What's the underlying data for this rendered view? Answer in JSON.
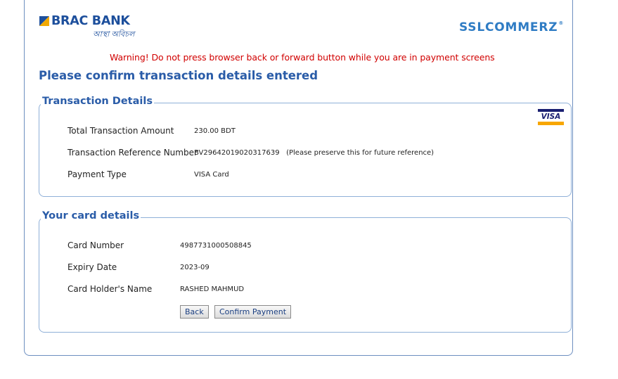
{
  "header": {
    "bank_name": "BRAC BANK",
    "bank_tagline": "আস্থা অবিচল",
    "gateway_name": "SSLCOMMERZ",
    "gateway_mark": "®"
  },
  "warning": "Warning! Do not press browser back or forward button while you are in payment screens",
  "page_title": "Please confirm transaction details entered",
  "transaction": {
    "legend": "Transaction Details",
    "card_brand": "VISA",
    "rows": [
      {
        "label": "Total Transaction Amount",
        "value": "230.00 BDT"
      },
      {
        "label": "Transaction Reference Number",
        "value": "BV29642019020317639   (Please preserve this for future reference)"
      },
      {
        "label": "Payment Type",
        "value": "VISA Card"
      }
    ]
  },
  "card": {
    "legend": "Your card details",
    "rows": [
      {
        "label": "Card Number",
        "value": "4987731000508845"
      },
      {
        "label": "Expiry Date",
        "value": "2023-09"
      },
      {
        "label": "Card Holder's Name",
        "value": "RASHED MAHMUD"
      }
    ],
    "back_label": "Back",
    "confirm_label": "Confirm Payment"
  },
  "colors": {
    "brand_blue": "#1d4f9c",
    "title_blue": "#2a5ca8",
    "warning_red": "#d10000",
    "gateway_blue": "#2f7cc4"
  },
  "icons": {
    "bank_logo": "brac-bank-logo",
    "gateway_logo": "sslcommerz-logo",
    "card_brand": "visa-icon"
  }
}
